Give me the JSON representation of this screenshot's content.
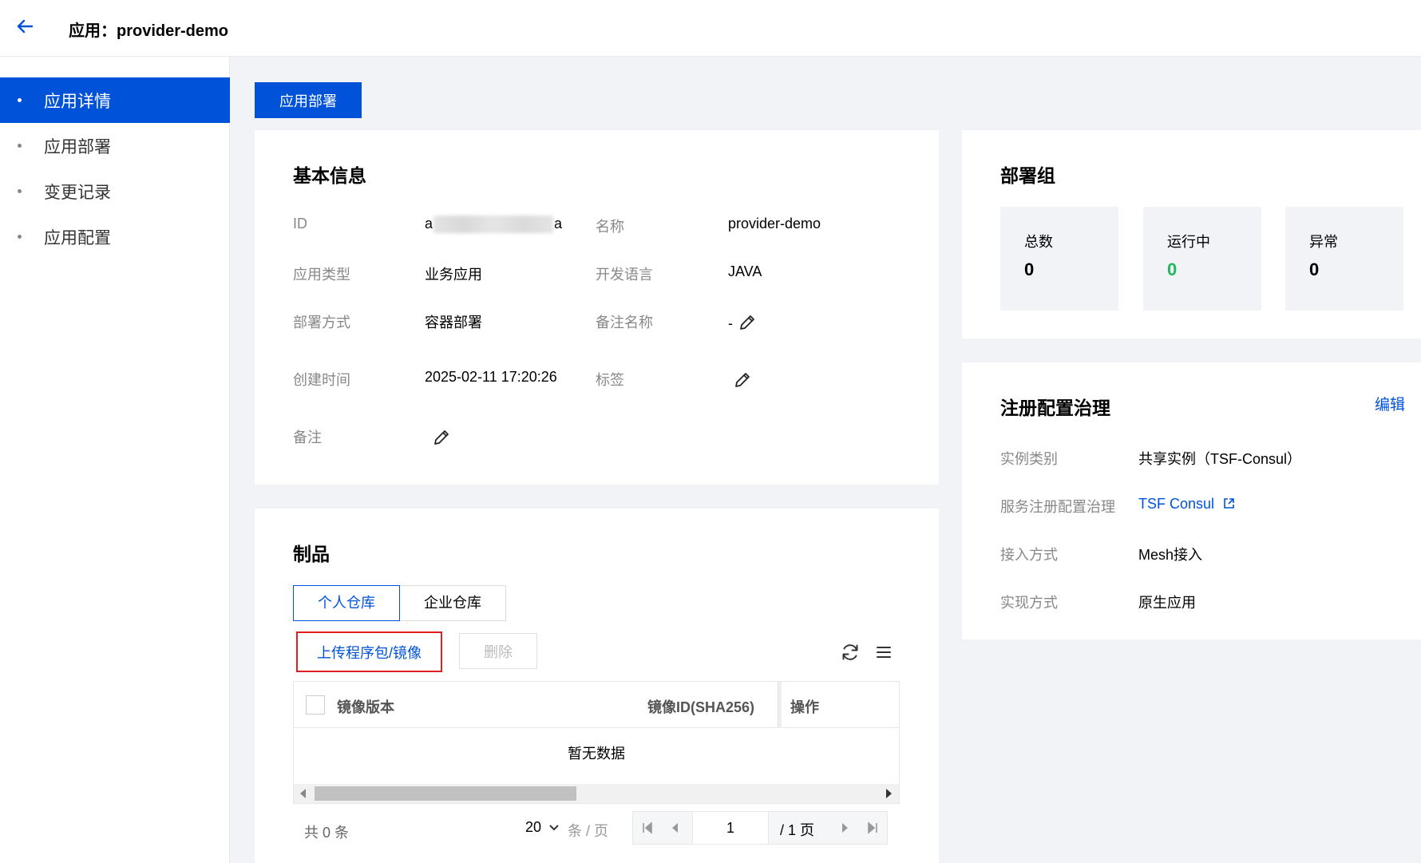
{
  "header": {
    "title": "应用：provider-demo"
  },
  "sidebar": {
    "items": [
      {
        "label": "应用详情"
      },
      {
        "label": "应用部署"
      },
      {
        "label": "变更记录"
      },
      {
        "label": "应用配置"
      }
    ]
  },
  "actions": {
    "deploy_label": "应用部署"
  },
  "basic_info": {
    "title": "基本信息",
    "id_label": "ID",
    "id_prefix": "a",
    "id_suffix": "a",
    "name_label": "名称",
    "name_value": "provider-demo",
    "app_type_label": "应用类型",
    "app_type_value": "业务应用",
    "language_label": "开发语言",
    "language_value": "JAVA",
    "deploy_mode_label": "部署方式",
    "deploy_mode_value": "容器部署",
    "remark_name_label": "备注名称",
    "remark_name_value": "-",
    "created_label": "创建时间",
    "created_value": "2025-02-11 17:20:26",
    "tags_label": "标签",
    "note_label": "备注"
  },
  "artifacts": {
    "title": "制品",
    "tabs": [
      {
        "label": "个人仓库"
      },
      {
        "label": "企业仓库"
      }
    ],
    "upload_label": "上传程序包/镜像",
    "delete_label": "删除",
    "columns": [
      "镜像版本",
      "镜像ID(SHA256)",
      "操作"
    ],
    "empty_text": "暂无数据",
    "pager": {
      "total": "共 0 条",
      "page_size": "20",
      "unit": "条 / 页",
      "current_page": "1",
      "pages": "/ 1 页"
    }
  },
  "deploy_group": {
    "title": "部署组",
    "stats": [
      {
        "label": "总数",
        "value": "0",
        "color": "#000000"
      },
      {
        "label": "运行中",
        "value": "0",
        "color": "#1fb85a"
      },
      {
        "label": "异常",
        "value": "0",
        "color": "#000000"
      }
    ]
  },
  "registry": {
    "title": "注册配置治理",
    "edit_label": "编辑",
    "rows": [
      {
        "label": "实例类别",
        "value": "共享实例（TSF-Consul）"
      },
      {
        "label": "服务注册配置治理",
        "value": "TSF Consul"
      },
      {
        "label": "接入方式",
        "value": "Mesh接入"
      },
      {
        "label": "实现方式",
        "value": "原生应用"
      }
    ]
  },
  "colors": {
    "primary": "#0052d9",
    "highlight_border": "#e02020",
    "running": "#1fb85a"
  }
}
